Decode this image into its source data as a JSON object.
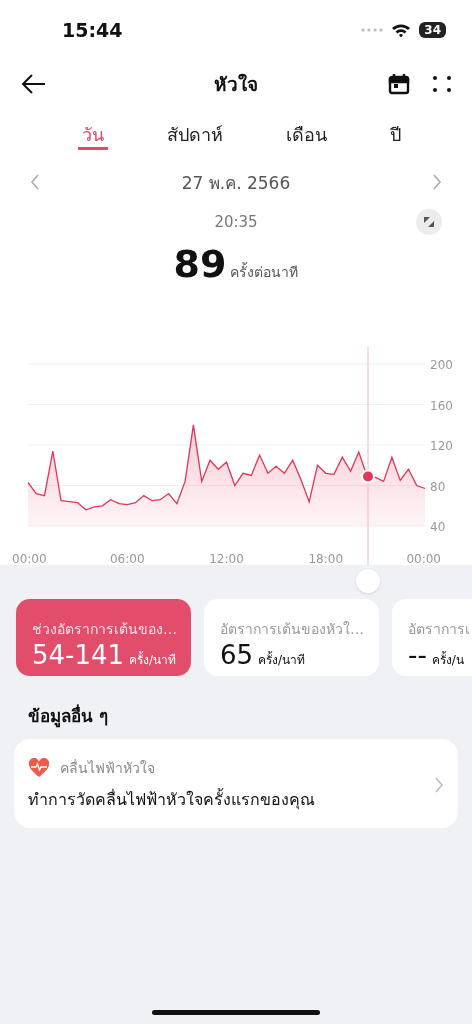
{
  "status_bar": {
    "time": "15:44",
    "battery": "34"
  },
  "header": {
    "title": "หัวใจ"
  },
  "tabs": [
    {
      "label": "วัน",
      "selected": true
    },
    {
      "label": "สัปดาห์",
      "selected": false
    },
    {
      "label": "เดือน",
      "selected": false
    },
    {
      "label": "ปี",
      "selected": false
    }
  ],
  "date": "27 พ.ค. 2566",
  "selected_time": "20:35",
  "reading": {
    "value": "89",
    "unit": "ครั้งต่อนาที"
  },
  "chart": {
    "chart_data": {
      "type": "area",
      "grid": true,
      "x": [
        0,
        0.5,
        1,
        1.5,
        2,
        2.5,
        3,
        3.5,
        4,
        4.5,
        5,
        5.5,
        6,
        6.5,
        7,
        7.5,
        8,
        8.5,
        9,
        9.5,
        10,
        10.5,
        11,
        11.5,
        12,
        12.5,
        13,
        13.5,
        14,
        14.5,
        15,
        15.5,
        16,
        16.5,
        17,
        17.5,
        18,
        18.5,
        19,
        19.5,
        20,
        20.5,
        21,
        21.5,
        22,
        22.5,
        23,
        23.5,
        24
      ],
      "series": [
        {
          "color": "#e8335a",
          "values": [
            83,
            72,
            70,
            114,
            65,
            64,
            63,
            56,
            59,
            60,
            66,
            62,
            61,
            63,
            70,
            65,
            66,
            72,
            62,
            84,
            140,
            84,
            105,
            96,
            103,
            80,
            92,
            90,
            110,
            92,
            99,
            92,
            105,
            86,
            64,
            100,
            92,
            91,
            108,
            94,
            113,
            89,
            88,
            84,
            108,
            85,
            96,
            80,
            77
          ]
        }
      ],
      "xlim": [
        0,
        24
      ],
      "ylim": [
        40,
        200
      ],
      "xticks": [
        {
          "value": 0,
          "label": "00:00"
        },
        {
          "value": 6,
          "label": "06:00"
        },
        {
          "value": 12,
          "label": "12:00"
        },
        {
          "value": 18,
          "label": "18:00"
        },
        {
          "value": 24,
          "label": "00:00"
        }
      ],
      "yticks": [
        40,
        80,
        120,
        160,
        200
      ]
    }
  },
  "summary_cards": [
    {
      "label": "ช่วงอัตราการเต้นของ…",
      "value": "54-141",
      "unit": "ครั้ง/นาที",
      "selected": true
    },
    {
      "label": "อัตราการเต้นของหัวใ…",
      "value": "65",
      "unit": "ครั้ง/นาที",
      "selected": false
    },
    {
      "label": "อัตราการเ",
      "value": "--",
      "unit": "ครั้ง/น",
      "selected": false
    }
  ],
  "other_info": {
    "title": "ข้อมูลอื่น ๆ",
    "items": [
      {
        "title": "คลื่นไฟฟ้าหัวใจ",
        "text": "ทำการวัดคลื่นไฟฟ้าหัวใจครั้งแรกของคุณ"
      }
    ]
  }
}
